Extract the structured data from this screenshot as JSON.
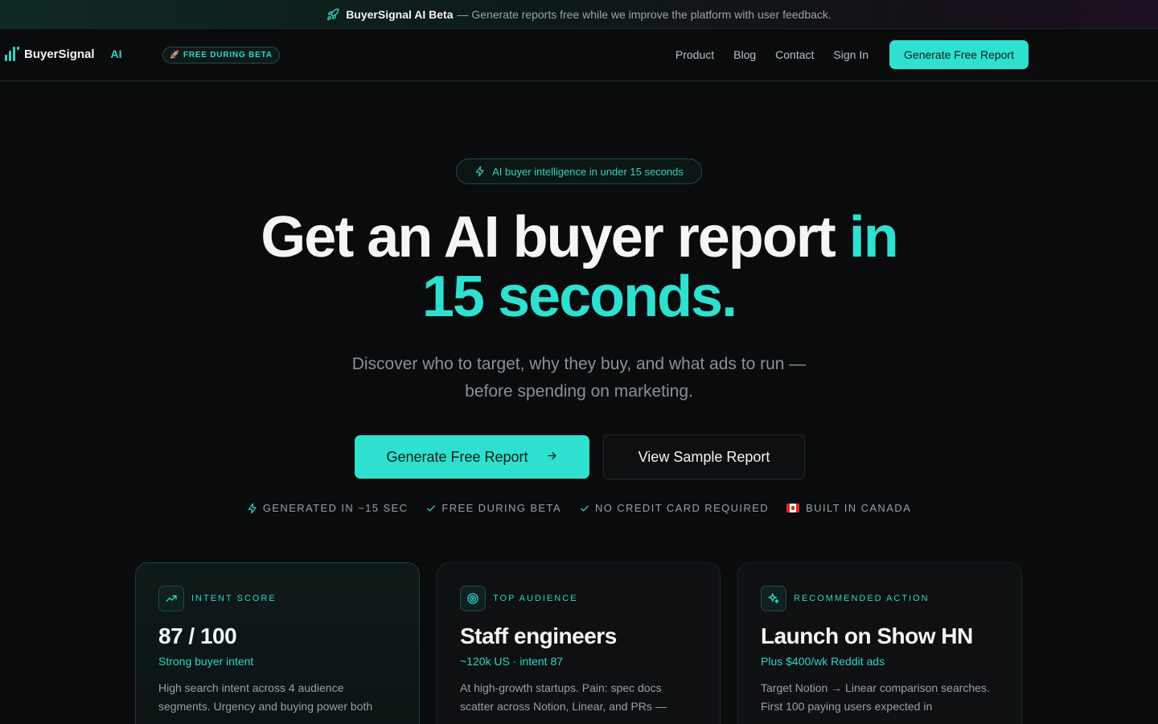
{
  "banner": {
    "brand": "BuyerSignal AI Beta",
    "text": "— Generate reports free while we improve the platform with user feedback."
  },
  "nav": {
    "logo_name": "BuyerSignal",
    "logo_ai": "AI",
    "beta_badge": "🚀 FREE DURING BETA",
    "links": [
      "Product",
      "Blog",
      "Contact",
      "Sign In"
    ],
    "cta": "Generate Free Report"
  },
  "hero": {
    "pill": "AI buyer intelligence in under 15 seconds",
    "headline_main": "Get an AI buyer report ",
    "headline_accent_1": "in",
    "headline_accent_2": "15 seconds.",
    "subtitle_line1": "Discover who to target, why they buy, and what ads to run —",
    "subtitle_line2": "before spending on marketing.",
    "primary_button": "Generate Free Report",
    "primary_arrow": "→",
    "secondary_button": "View Sample Report"
  },
  "trust": [
    {
      "icon": "bolt-icon",
      "label": "GENERATED IN ~15 SEC"
    },
    {
      "icon": "check-icon",
      "label": "FREE DURING BETA"
    },
    {
      "icon": "check-icon",
      "label": "NO CREDIT CARD REQUIRED"
    },
    {
      "icon": "canada-flag-icon",
      "label": "BUILT IN CANADA"
    }
  ],
  "cards": [
    {
      "icon": "trending-up-icon",
      "tag": "INTENT SCORE",
      "title": "87 / 100",
      "subtitle": "Strong buyer intent",
      "description": "High search intent across 4 audience segments. Urgency and buying power both"
    },
    {
      "icon": "target-icon",
      "tag": "TOP AUDIENCE",
      "title": "Staff engineers",
      "subtitle": "~120k US · intent 87",
      "description": "At high-growth startups. Pain: spec docs scatter across Notion, Linear, and PRs —"
    },
    {
      "icon": "sparkles-icon",
      "tag": "RECOMMENDED ACTION",
      "title": "Launch on Show HN",
      "subtitle": "Plus $400/wk Reddit ads",
      "description": "Target Notion → Linear comparison searches. First 100 paying users expected in"
    }
  ],
  "colors": {
    "accent": "#2ee0cf",
    "background": "#0a0b0c"
  }
}
